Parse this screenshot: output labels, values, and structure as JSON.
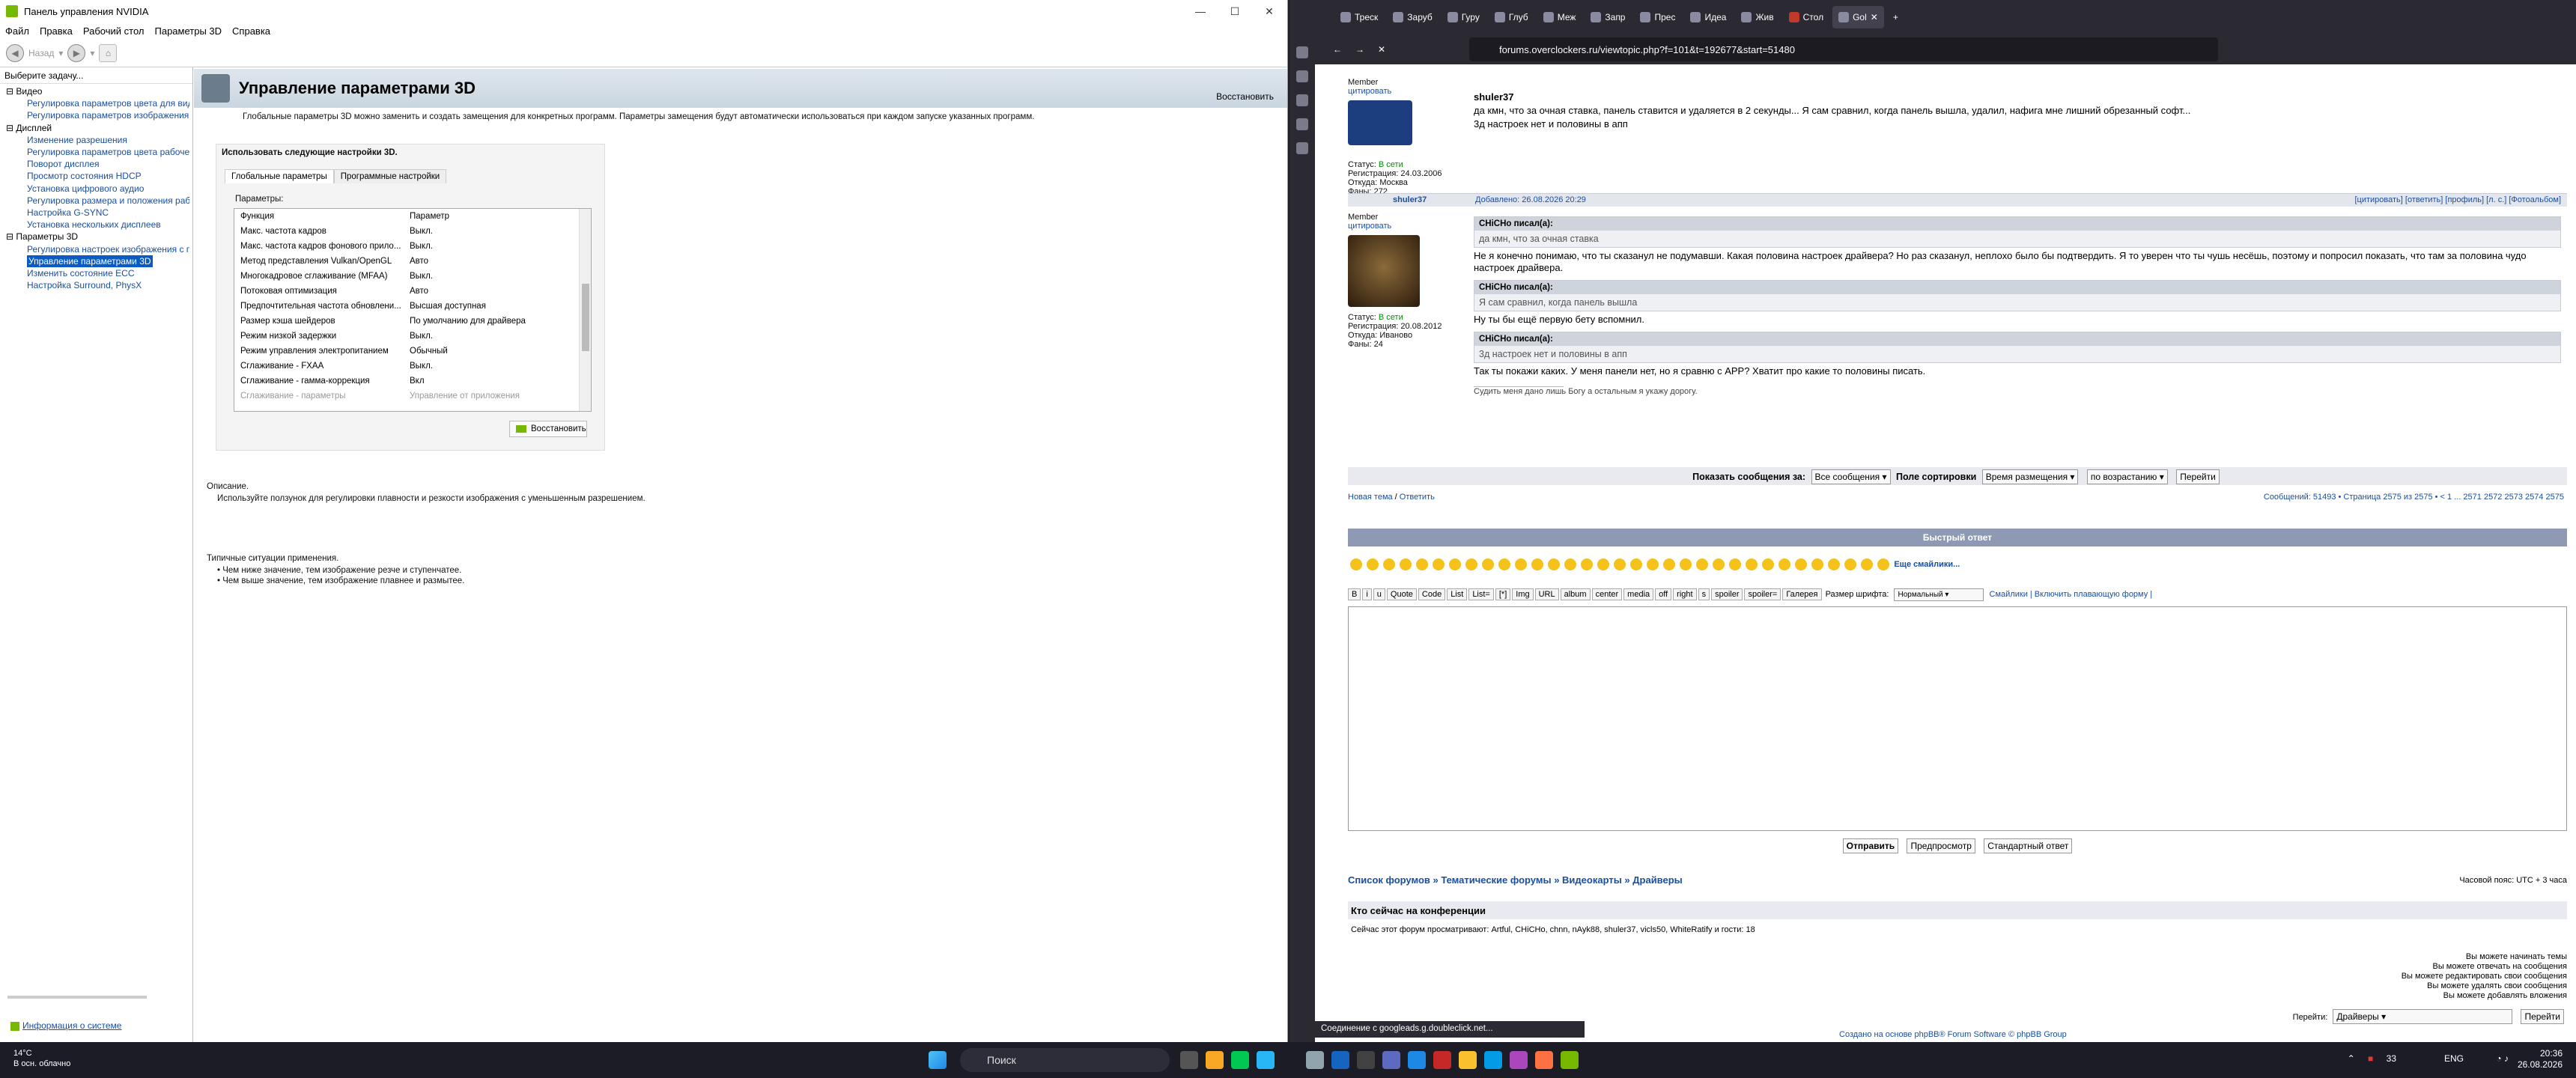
{
  "nvidia": {
    "title": "Панель управления NVIDIA",
    "menu": [
      "Файл",
      "Правка",
      "Рабочий стол",
      "Параметры 3D",
      "Справка"
    ],
    "toolbar": {
      "back": "Назад"
    },
    "left_header": "Выберите задачу...",
    "tree": [
      {
        "cat": "Видео",
        "items": [
          "Регулировка параметров цвета для вид",
          "Регулировка параметров изображения д"
        ]
      },
      {
        "cat": "Дисплей",
        "items": [
          "Изменение разрешения",
          "Регулировка параметров цвета рабочег",
          "Поворот дисплея",
          "Просмотр состояния HDCP",
          "Установка цифрового аудио",
          "Регулировка размера и положения раб",
          "Настройка G-SYNC",
          "Установка нескольких дисплеев"
        ]
      },
      {
        "cat": "Параметры 3D",
        "items": [
          "Регулировка настроек изображения с пр",
          "Управление параметрами 3D",
          "Изменить состояние ECC",
          "Настройка Surround, PhysX"
        ]
      }
    ],
    "selected_item": "Управление параметрами 3D",
    "sysinfo": "Информация о системе",
    "page_title": "Управление параметрами 3D",
    "restore_top": "Восстановить",
    "intro": "Глобальные параметры 3D можно заменить и создать замещения для конкретных программ. Параметры замещения будут автоматически использоваться при каждом запуске указанных программ.",
    "use_label": "Использовать следующие настройки 3D.",
    "tabs": [
      "Глобальные параметры",
      "Программные настройки"
    ],
    "params_label": "Параметры:",
    "col_headers": [
      "Функция",
      "Параметр"
    ],
    "rows": [
      [
        "Макс. частота кадров",
        "Выкл."
      ],
      [
        "Макс. частота кадров фонового прило...",
        "Выкл."
      ],
      [
        "Метод представления Vulkan/OpenGL",
        "Авто"
      ],
      [
        "Многокадровое сглаживание (MFAA)",
        "Выкл."
      ],
      [
        "Потоковая оптимизация",
        "Авто"
      ],
      [
        "Предпочтительная частота обновлени...",
        "Высшая доступная"
      ],
      [
        "Размер кэша шейдеров",
        "По умолчанию для драйвера"
      ],
      [
        "Режим низкой задержки",
        "Выкл."
      ],
      [
        "Режим управления электропитанием",
        "Обычный"
      ],
      [
        "Сглаживание - FXAA",
        "Выкл."
      ],
      [
        "Сглаживание - гамма-коррекция",
        "Вкл"
      ],
      [
        "Сглаживание - параметры",
        "Управление от приложения"
      ]
    ],
    "restore_btn": "Восстановить",
    "desc_label": "Описание.",
    "desc_text": "Используйте ползунок для регулировки плавности и резкости изображения с уменьшенным разрешением.",
    "typical_label": "Типичные ситуации применения.",
    "typical": [
      "Чем ниже значение, тем изображение резче и ступенчатее.",
      "Чем выше значение, тем изображение плавнее и размытее."
    ]
  },
  "browser": {
    "tabs": [
      "Треск",
      "Заруб",
      "Гуру",
      "Глуб",
      "Меж",
      "Запр",
      "Прес",
      "Идеа",
      "Жив",
      "Стол",
      "Gol"
    ],
    "url": "forums.overclockers.ru/viewtopic.php?f=101&t=192677&start=51480",
    "post1": {
      "role": "Member",
      "quote_link": "цитировать",
      "author": "shuler37",
      "text": "да кмн, что за очная ставка, панель ставится и удаляется в 2 секунды... Я сам сравнил, когда панель вышла, удалил, нафига мне лишний обрезанный софт...",
      "text2": "3д настроек нет и половины в апп",
      "status_label": "Статус:",
      "status": "В сети",
      "reg": "Регистрация: 24.03.2006",
      "from": "Откуда: Москва",
      "fans": "Фаны: 272"
    },
    "post2": {
      "author": "shuler37",
      "date": "Добавлено: 26.08.2026 20:29",
      "actions": "[цитировать] [ответить] [профиль] [л. с.] [Фотоальбом]",
      "role": "Member",
      "quote_link": "цитировать",
      "status_label": "Статус:",
      "status": "В сети",
      "reg": "Регистрация: 20.08.2012",
      "from": "Откуда: Иваново",
      "fans": "Фаны: 24",
      "q1_head": "CHiCHo писал(а):",
      "q1": "да кмн, что за очная ставка",
      "t1": "Не я конечно понимаю, что ты сказанул не подумавши. Какая половина настроек драйвера? Но раз сказанул, неплохо было бы подтвердить. Я то уверен что ты чушь несёшь, поэтому и попросил показать, что там за половина чудо настроек драйвера.",
      "q2_head": "CHiCHo писал(а):",
      "q2": "Я сам сравнил, когда панель вышла",
      "t2": "Ну ты бы ещё первую бету вспомнил.",
      "q3_head": "CHiCHo писал(а):",
      "q3": "3д настроек нет и половины в апп",
      "t3": "Так ты покажи каких. У меня панели нет, но я сравню с APP? Хватит про какие то половины писать.",
      "sig": "Судить меня дано лишь Богу а остальным я укажу дорогу."
    },
    "filter": {
      "label": "Показать сообщения за:",
      "period": "Все сообщения",
      "sort_label": "Поле сортировки",
      "sort": "Время размещения",
      "order": "по возрастанию",
      "go": "Перейти"
    },
    "new_topic": "Новая тема",
    "reply": "Ответить",
    "pagination": "Сообщений: 51493 • Страница 2575 из 2575 • < 1 ... 2571 2572 2573 2574 2575",
    "quick_reply": "Быстрый ответ",
    "more_smiles": "Еще смайлики...",
    "editor_buttons": [
      "B",
      "i",
      "u",
      "Quote",
      "Code",
      "List",
      "List=",
      "[*]",
      "Img",
      "URL",
      "album",
      "center",
      "media",
      "off",
      "right",
      "s",
      "spoiler",
      "spoiler=",
      "Галерея"
    ],
    "font_size_label": "Размер шрифта:",
    "font_size": "Нормальный",
    "smiles_link": "Смайлики | Включить плавающую форму |",
    "send": "Отправить",
    "preview": "Предпросмотр",
    "standard": "Стандартный ответ",
    "breadcrumb": "Список форумов » Тематические форумы » Видеокарты » Драйверы",
    "timezone": "Часовой пояс: UTC + 3 часа",
    "online_title": "Кто сейчас на конференции",
    "online_text": "Сейчас этот форум просматривают: Artful, CHiCHo, chnn, nAyk88, shuler37, vicls50, WhiteRatify и гости: 18",
    "perms": [
      "Вы можете начинать темы",
      "Вы можете отвечать на сообщения",
      "Вы можете редактировать свои сообщения",
      "Вы можете удалять свои сообщения",
      "Вы можете добавлять вложения"
    ],
    "jump_label": "Перейти:",
    "jump": "Драйверы",
    "jump_btn": "Перейти",
    "footer": "Создано на основе phpBB® Forum Software © phpBB Group",
    "status_bar": "Соединение с googleads.g.doubleclick.net..."
  },
  "taskbar": {
    "weather_temp": "14°C",
    "weather_text": "В осн. облачно",
    "search": "Поиск",
    "lang": "ENG",
    "tray_num": "33",
    "time": "20:36",
    "date": "26.08.2026"
  }
}
